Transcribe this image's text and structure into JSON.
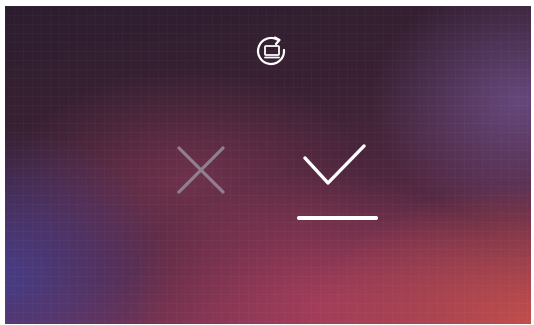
{
  "screen": {
    "background_colors": [
      "#2b1d2e",
      "#5a2a45",
      "#c44e4a",
      "#463e8c"
    ]
  },
  "controls": {
    "rotate": {
      "icon": "rotate-screen-icon",
      "color": "#ffffff"
    },
    "cancel": {
      "icon": "close-icon",
      "color": "#8f7f90"
    },
    "confirm": {
      "icon": "checkmark-icon",
      "color": "#ffffff",
      "selected": true
    }
  }
}
